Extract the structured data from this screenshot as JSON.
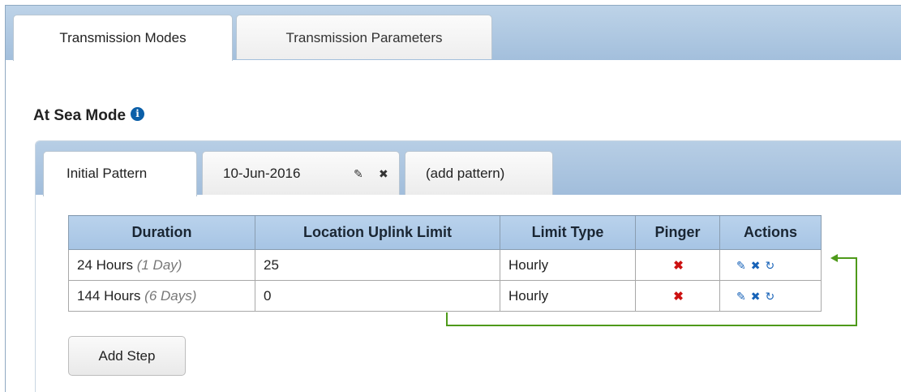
{
  "top_tabs": [
    {
      "label": "Transmission Modes"
    },
    {
      "label": "Transmission Parameters"
    }
  ],
  "section": {
    "title": "At Sea Mode",
    "info_icon": "info-circle-icon"
  },
  "pattern_tabs": [
    {
      "label": "Initial Pattern"
    },
    {
      "label": "10-Jun-2016",
      "edit_icon": "pencil-icon",
      "delete_icon": "close-icon"
    },
    {
      "label": "(add pattern)"
    }
  ],
  "table": {
    "headers": [
      "Duration",
      "Location Uplink Limit",
      "Limit Type",
      "Pinger",
      "Actions"
    ],
    "rows": [
      {
        "duration": "24 Hours",
        "duration_days": "(1 Day)",
        "limit": "25",
        "limit_type": "Hourly",
        "pinger": "✖"
      },
      {
        "duration": "144 Hours",
        "duration_days": "(6 Days)",
        "limit": "0",
        "limit_type": "Hourly",
        "pinger": "✖"
      }
    ],
    "action_icons": [
      "pencil-icon",
      "delete-icon",
      "loop-icon"
    ]
  },
  "add_step_label": "Add Step",
  "colors": {
    "accent": "#0b5fa8",
    "pinger_off": "#cc1111",
    "connector": "#4e9a1a",
    "header_bg": "#b2cbe7"
  }
}
